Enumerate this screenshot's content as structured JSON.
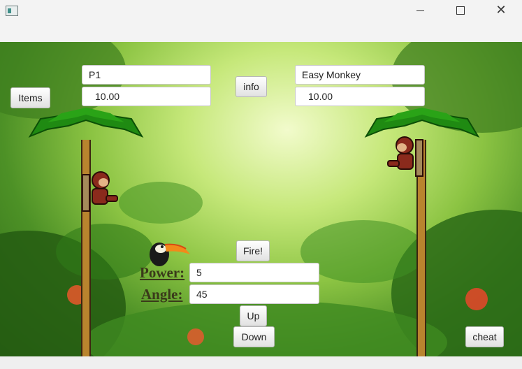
{
  "window": {
    "controls": [
      "minimize",
      "maximize",
      "close"
    ]
  },
  "player1": {
    "name": "P1",
    "score": "10.00"
  },
  "player2": {
    "name": "Easy Monkey",
    "score": "10.00"
  },
  "buttons": {
    "items": "Items",
    "info": "info",
    "fire": "Fire!",
    "up": "Up",
    "down": "Down",
    "cheat": "cheat"
  },
  "controls": {
    "power_label": "Power:",
    "power_value": "5",
    "angle_label": "Angle:",
    "angle_value": "45"
  },
  "icons": {
    "player1": "monkey-icon",
    "player2": "monkey-icon",
    "bird": "toucan-icon",
    "tree": "palm-tree-icon"
  },
  "colors": {
    "trunk": "#b9842e",
    "leaves": "#1f8a12",
    "monkey": "#8a2a1c"
  }
}
